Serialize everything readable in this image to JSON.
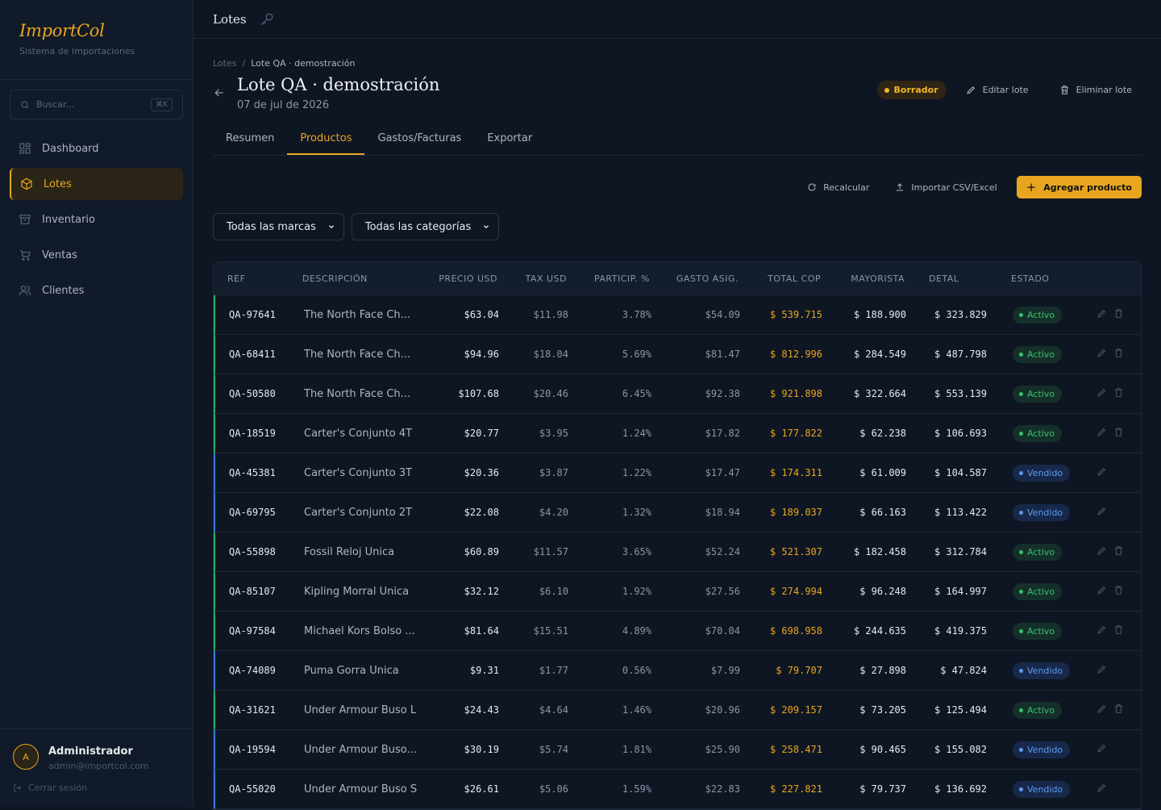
{
  "brand": {
    "name": "ImportCol",
    "subtitle": "Sistema de importaciones"
  },
  "search": {
    "placeholder": "Buscar...",
    "shortcut": "⌘K"
  },
  "nav": [
    {
      "label": "Dashboard",
      "icon": "grid-icon"
    },
    {
      "label": "Lotes",
      "icon": "box-icon",
      "active": true
    },
    {
      "label": "Inventario",
      "icon": "archive-icon"
    },
    {
      "label": "Ventas",
      "icon": "cart-icon"
    },
    {
      "label": "Clientes",
      "icon": "users-icon"
    }
  ],
  "user": {
    "initial": "A",
    "name": "Administrador",
    "email": "admin@importcol.com",
    "logout": "Cerrar sesión"
  },
  "topbar": {
    "title": "Lotes"
  },
  "breadcrumb": {
    "root": "Lotes",
    "sep": "/",
    "current": "Lote QA · demostración"
  },
  "page": {
    "title": "Lote QA · demostración",
    "date": "07 de jul de 2026",
    "status": "Borrador",
    "edit": "Editar lote",
    "delete": "Eliminar lote"
  },
  "tabs": [
    "Resumen",
    "Productos",
    "Gastos/Facturas",
    "Exportar"
  ],
  "toolbar": {
    "recalc": "Recalcular",
    "import": "Importar CSV/Excel",
    "add": "Agregar producto"
  },
  "filters": {
    "brand": "Todas las marcas",
    "category": "Todas las categorías"
  },
  "columns": [
    "REF",
    "DESCRIPCIÓN",
    "PRECIO USD",
    "TAX USD",
    "PARTICIP. %",
    "GASTO ASIG.",
    "TOTAL COP",
    "MAYORISTA",
    "DETAL",
    "ESTADO"
  ],
  "colors": {
    "accent": "#e8a620",
    "activo": "#39c16e",
    "vendido": "#5b9bf0"
  },
  "rows": [
    {
      "ref": "QA-97641",
      "desc": "The North Face Ch...",
      "price": "$63.04",
      "tax": "$11.98",
      "part": "3.78%",
      "gasto": "$54.09",
      "total": "$ 539.715",
      "mayor": "$ 188.900",
      "detal": "$ 323.829",
      "estado": "Activo"
    },
    {
      "ref": "QA-68411",
      "desc": "The North Face Ch...",
      "price": "$94.96",
      "tax": "$18.04",
      "part": "5.69%",
      "gasto": "$81.47",
      "total": "$ 812.996",
      "mayor": "$ 284.549",
      "detal": "$ 487.798",
      "estado": "Activo"
    },
    {
      "ref": "QA-50580",
      "desc": "The North Face Ch...",
      "price": "$107.68",
      "tax": "$20.46",
      "part": "6.45%",
      "gasto": "$92.38",
      "total": "$ 921.898",
      "mayor": "$ 322.664",
      "detal": "$ 553.139",
      "estado": "Activo"
    },
    {
      "ref": "QA-18519",
      "desc": "Carter's Conjunto 4T",
      "price": "$20.77",
      "tax": "$3.95",
      "part": "1.24%",
      "gasto": "$17.82",
      "total": "$ 177.822",
      "mayor": "$ 62.238",
      "detal": "$ 106.693",
      "estado": "Activo"
    },
    {
      "ref": "QA-45381",
      "desc": "Carter's Conjunto 3T",
      "price": "$20.36",
      "tax": "$3.87",
      "part": "1.22%",
      "gasto": "$17.47",
      "total": "$ 174.311",
      "mayor": "$ 61.009",
      "detal": "$ 104.587",
      "estado": "Vendido"
    },
    {
      "ref": "QA-69795",
      "desc": "Carter's Conjunto 2T",
      "price": "$22.08",
      "tax": "$4.20",
      "part": "1.32%",
      "gasto": "$18.94",
      "total": "$ 189.037",
      "mayor": "$ 66.163",
      "detal": "$ 113.422",
      "estado": "Vendido"
    },
    {
      "ref": "QA-55898",
      "desc": "Fossil Reloj Única",
      "price": "$60.89",
      "tax": "$11.57",
      "part": "3.65%",
      "gasto": "$52.24",
      "total": "$ 521.307",
      "mayor": "$ 182.458",
      "detal": "$ 312.784",
      "estado": "Activo"
    },
    {
      "ref": "QA-85107",
      "desc": "Kipling Morral Única",
      "price": "$32.12",
      "tax": "$6.10",
      "part": "1.92%",
      "gasto": "$27.56",
      "total": "$ 274.994",
      "mayor": "$ 96.248",
      "detal": "$ 164.997",
      "estado": "Activo"
    },
    {
      "ref": "QA-97584",
      "desc": "Michael Kors Bolso ...",
      "price": "$81.64",
      "tax": "$15.51",
      "part": "4.89%",
      "gasto": "$70.04",
      "total": "$ 698.958",
      "mayor": "$ 244.635",
      "detal": "$ 419.375",
      "estado": "Activo"
    },
    {
      "ref": "QA-74089",
      "desc": "Puma Gorra Única",
      "price": "$9.31",
      "tax": "$1.77",
      "part": "0.56%",
      "gasto": "$7.99",
      "total": "$ 79.707",
      "mayor": "$ 27.898",
      "detal": "$ 47.824",
      "estado": "Vendido"
    },
    {
      "ref": "QA-31621",
      "desc": "Under Armour Buso L",
      "price": "$24.43",
      "tax": "$4.64",
      "part": "1.46%",
      "gasto": "$20.96",
      "total": "$ 209.157",
      "mayor": "$ 73.205",
      "detal": "$ 125.494",
      "estado": "Activo"
    },
    {
      "ref": "QA-19594",
      "desc": "Under Armour Buso...",
      "price": "$30.19",
      "tax": "$5.74",
      "part": "1.81%",
      "gasto": "$25.90",
      "total": "$ 258.471",
      "mayor": "$ 90.465",
      "detal": "$ 155.082",
      "estado": "Vendido"
    },
    {
      "ref": "QA-55020",
      "desc": "Under Armour Buso S",
      "price": "$26.61",
      "tax": "$5.06",
      "part": "1.59%",
      "gasto": "$22.83",
      "total": "$ 227.821",
      "mayor": "$ 79.737",
      "detal": "$ 136.692",
      "estado": "Vendido"
    }
  ]
}
